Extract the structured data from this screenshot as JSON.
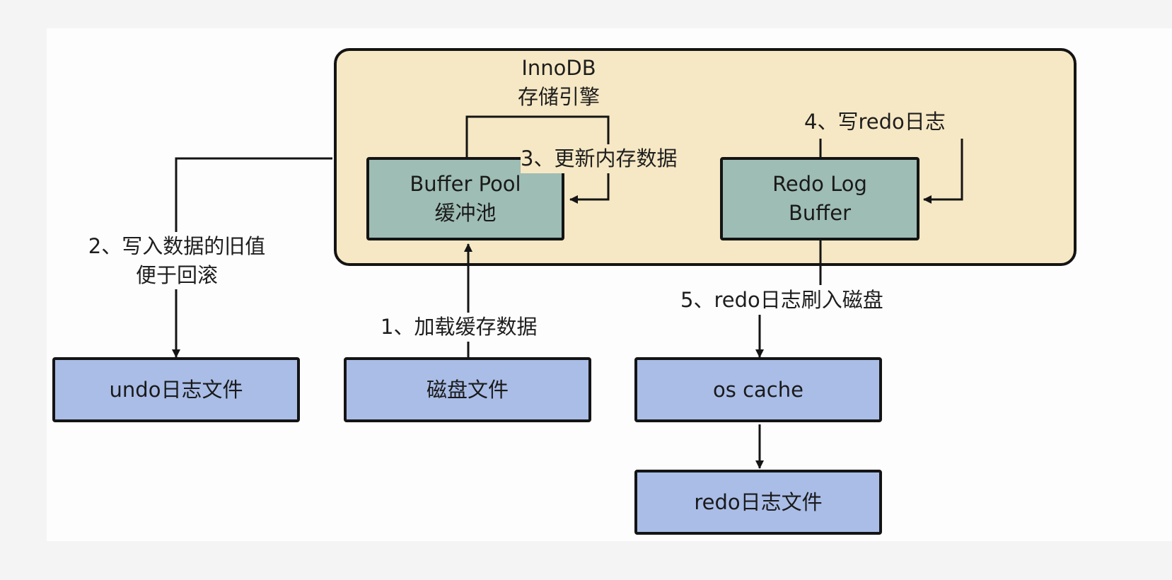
{
  "engine": {
    "title_line1": "InnoDB",
    "title_line2": "存储引擎"
  },
  "boxes": {
    "buffer_pool": {
      "line1": "Buffer Pool",
      "line2": "缓冲池"
    },
    "redo_log_buffer": {
      "line1": "Redo Log",
      "line2": "Buffer"
    },
    "undo_log_file": "undo日志文件",
    "disk_file": "磁盘文件",
    "os_cache": "os cache",
    "redo_log_file": "redo日志文件"
  },
  "steps": {
    "step1": "1、加载缓存数据",
    "step2_line1": "2、写入数据的旧值",
    "step2_line2": "便于回滚",
    "step3": "3、更新内存数据",
    "step4": "4、写redo日志",
    "step5": "5、redo日志刷入磁盘"
  },
  "colors": {
    "engine_fill": "#f6e8c4",
    "memory_box_fill": "#9ebdb4",
    "file_box_fill": "#a9bde7",
    "stroke": "#141414"
  }
}
